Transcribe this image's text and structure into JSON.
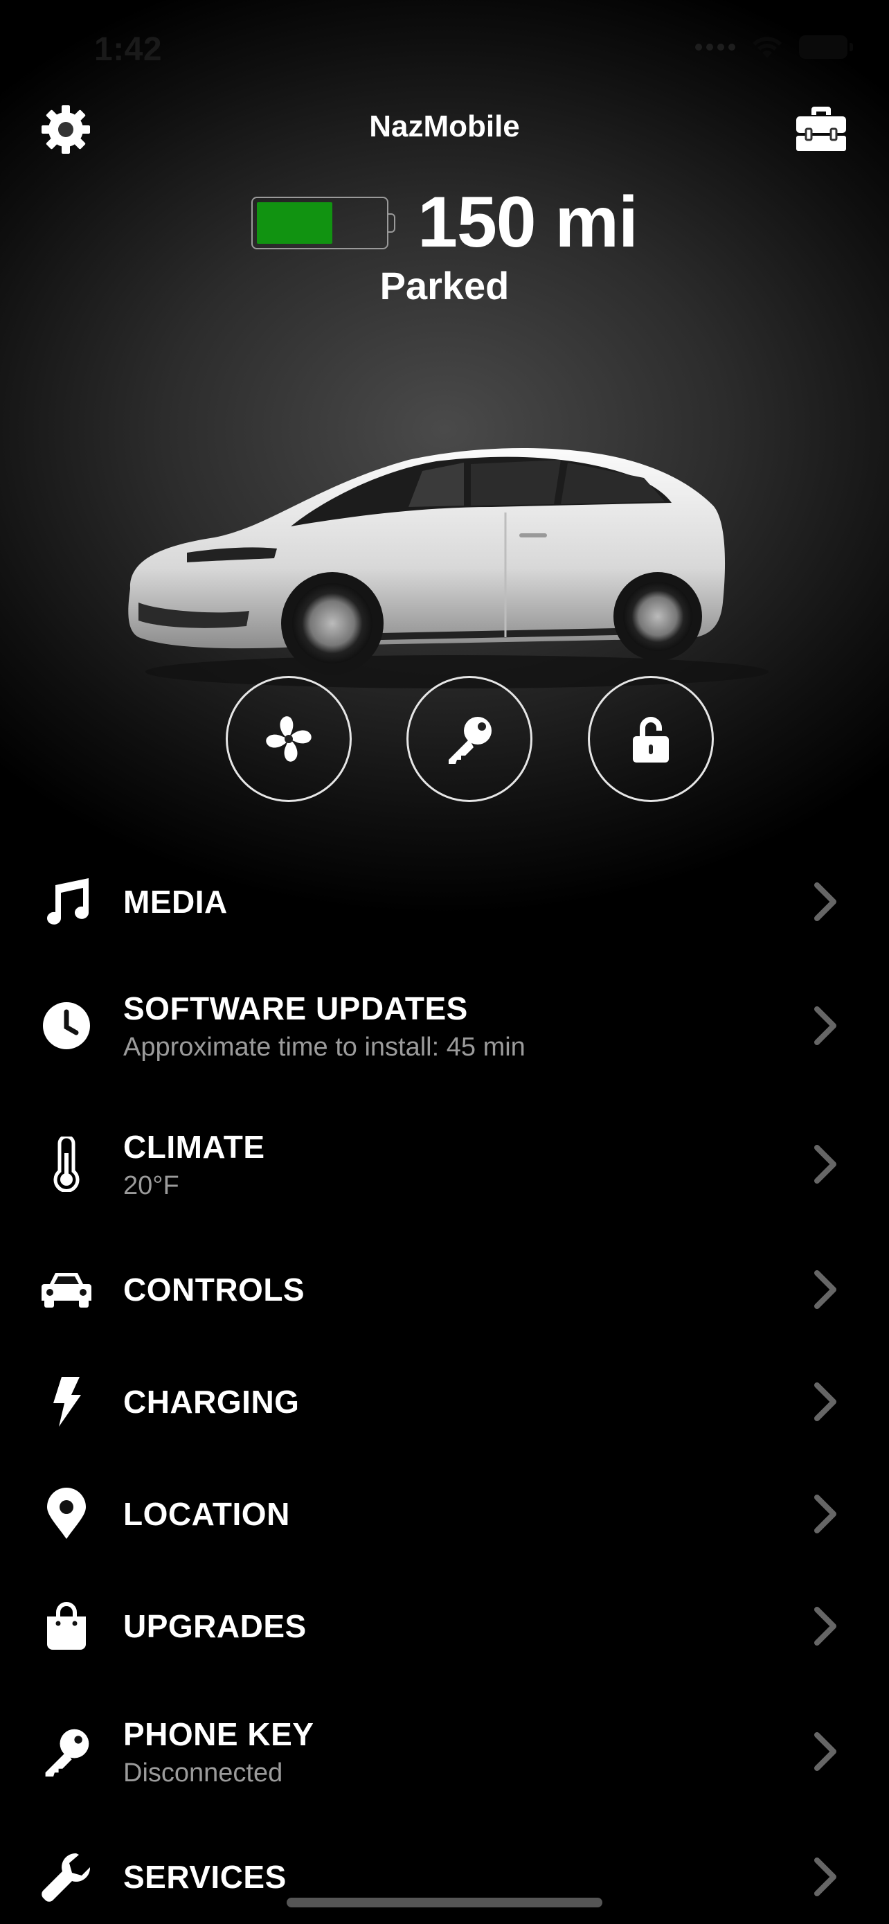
{
  "status_bar": {
    "time": "1:42"
  },
  "header": {
    "title": "NazMobile"
  },
  "vehicle": {
    "range": "150 mi",
    "state": "Parked",
    "battery_level": 0.6,
    "battery_color": "#119311"
  },
  "actions": [
    {
      "name": "fan-button",
      "icon": "fan-icon"
    },
    {
      "name": "key-button",
      "icon": "key-icon"
    },
    {
      "name": "unlock-button",
      "icon": "unlock-icon"
    }
  ],
  "menu": [
    {
      "label": "MEDIA",
      "sub": "",
      "icon": "music-note-icon"
    },
    {
      "label": "SOFTWARE UPDATES",
      "sub": "Approximate time to install: 45 min",
      "icon": "clock-icon"
    },
    {
      "label": "CLIMATE",
      "sub": "20°F",
      "icon": "thermometer-icon"
    },
    {
      "label": "CONTROLS",
      "sub": "",
      "icon": "car-icon"
    },
    {
      "label": "CHARGING",
      "sub": "",
      "icon": "bolt-icon"
    },
    {
      "label": "LOCATION",
      "sub": "",
      "icon": "map-pin-icon"
    },
    {
      "label": "UPGRADES",
      "sub": "",
      "icon": "shopping-bag-icon"
    },
    {
      "label": "PHONE KEY",
      "sub": "Disconnected",
      "icon": "key-icon"
    },
    {
      "label": "SERVICES",
      "sub": "",
      "icon": "wrench-icon"
    }
  ]
}
